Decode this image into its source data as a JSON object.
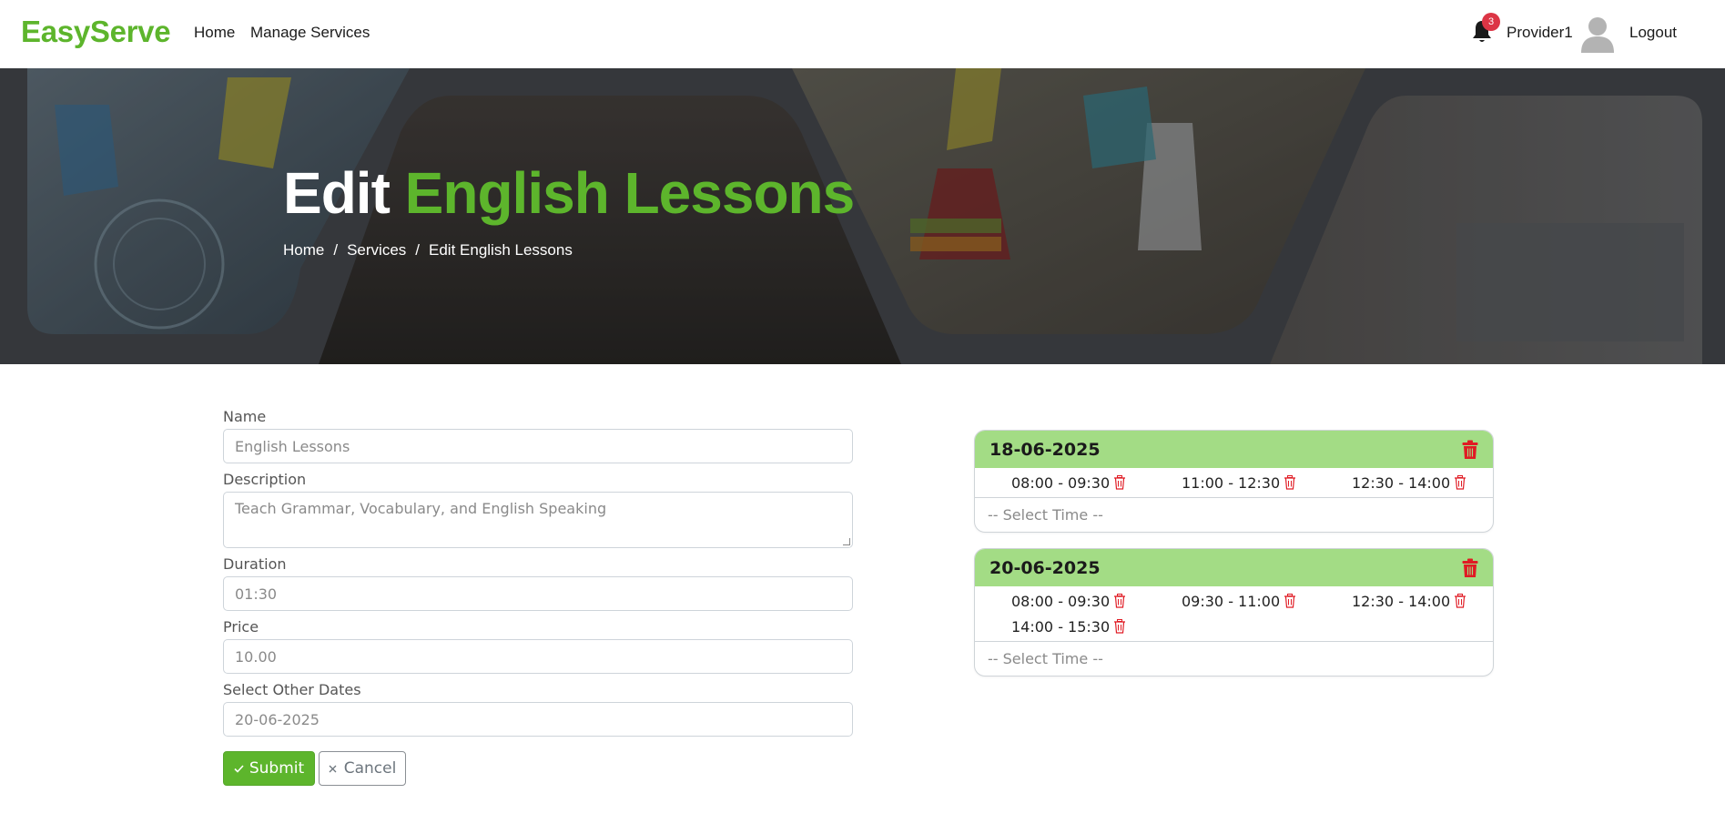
{
  "navbar": {
    "brand": "EasyServe",
    "links": {
      "home": "Home",
      "manage_services": "Manage Services"
    },
    "notifications_count": "3",
    "username": "Provider1",
    "logout": "Logout"
  },
  "hero": {
    "title_prefix": "Edit",
    "title_highlight": "English Lessons",
    "breadcrumb": [
      "Home",
      "Services",
      "Edit English Lessons"
    ],
    "breadcrumb_separator": "/"
  },
  "form": {
    "name": {
      "label": "Name",
      "placeholder": "English Lessons"
    },
    "description": {
      "label": "Description",
      "placeholder": "Teach Grammar, Vocabulary, and English Speaking"
    },
    "duration": {
      "label": "Duration",
      "placeholder": "01:30"
    },
    "price": {
      "label": "Price",
      "placeholder": "10.00"
    },
    "other_dates": {
      "label": "Select Other Dates",
      "placeholder": "20-06-2025"
    },
    "submit_label": "Submit",
    "cancel_label": "Cancel"
  },
  "dates": [
    {
      "date": "18-06-2025",
      "slots": [
        "08:00 - 09:30",
        "11:00 - 12:30",
        "12:30 - 14:00"
      ],
      "select_placeholder": "-- Select Time --"
    },
    {
      "date": "20-06-2025",
      "slots": [
        "08:00 - 09:30",
        "09:30 - 11:00",
        "12:30 - 14:00",
        "14:00 - 15:30"
      ],
      "select_placeholder": "-- Select Time --"
    }
  ],
  "colors": {
    "brand": "#5db52c",
    "card_header": "#a3dc85",
    "danger": "#dc3545"
  },
  "icons": {
    "bell": "bell-icon",
    "avatar": "user-avatar-icon",
    "trash": "trash-icon",
    "check": "check-icon",
    "close": "close-icon"
  }
}
